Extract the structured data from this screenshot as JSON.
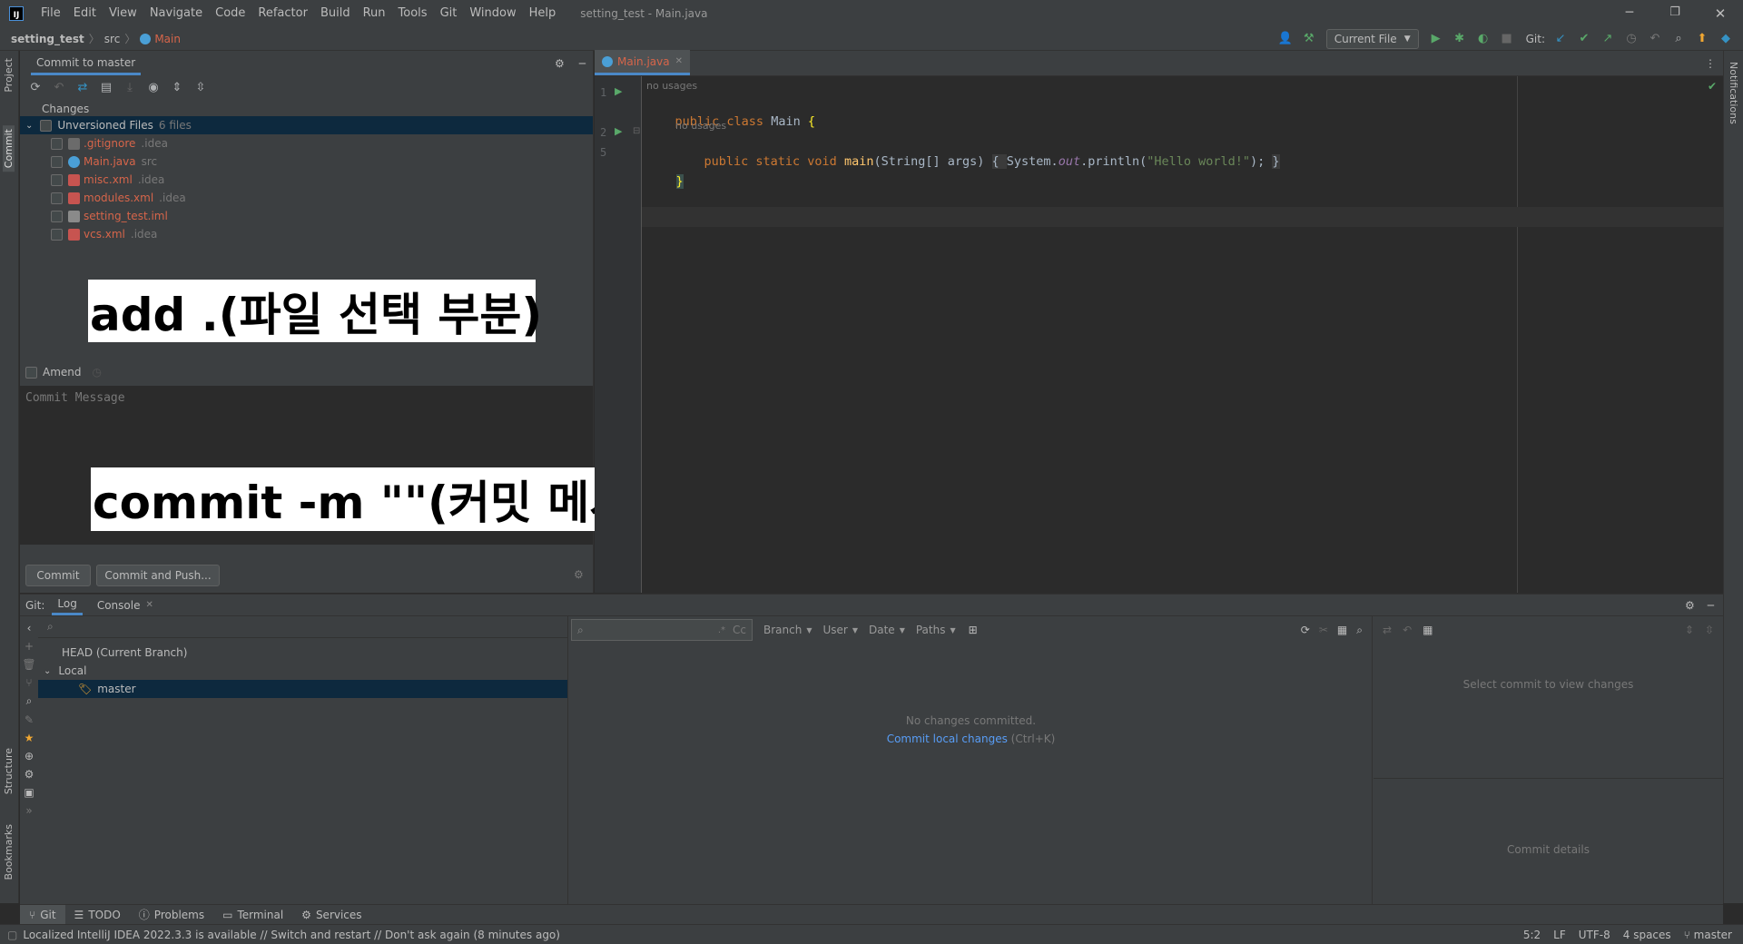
{
  "app": {
    "title": "setting_test - Main.java",
    "logo": "IJ"
  },
  "menu": [
    "File",
    "Edit",
    "View",
    "Navigate",
    "Code",
    "Refactor",
    "Build",
    "Run",
    "Tools",
    "Git",
    "Window",
    "Help"
  ],
  "breadcrumb": {
    "project": "setting_test",
    "dir": "src",
    "file": "Main"
  },
  "toolbar": {
    "run_config": "Current File",
    "git_label": "Git:"
  },
  "left_strip": {
    "project": "Project",
    "commit": "Commit",
    "structure": "Structure",
    "bookmarks": "Bookmarks"
  },
  "right_strip": {
    "notifications": "Notifications"
  },
  "commit_panel": {
    "title": "Commit to master",
    "changes_label": "Changes",
    "group": {
      "label": "Unversioned Files",
      "count": "6 files"
    },
    "files": [
      {
        "name": ".gitignore",
        "dir": ".idea"
      },
      {
        "name": "Main.java",
        "dir": "src"
      },
      {
        "name": "misc.xml",
        "dir": ".idea"
      },
      {
        "name": "modules.xml",
        "dir": ".idea"
      },
      {
        "name": "setting_test.iml",
        "dir": ""
      },
      {
        "name": "vcs.xml",
        "dir": ".idea"
      }
    ],
    "amend": "Amend",
    "message_placeholder": "Commit Message",
    "commit_button": "Commit",
    "commit_push_button": "Commit and Push..."
  },
  "captions": {
    "add": "add .(파일 선택 부분)",
    "commit": "commit -m \"\"(커밋 메시지 작성하는 부분)"
  },
  "editor": {
    "tab": "Main.java",
    "hint1": "no usages",
    "hint2": "no usages",
    "line_numbers": [
      "1",
      "2",
      "5"
    ],
    "line1": {
      "kw": "public class ",
      "name": "Main ",
      "brace": "{"
    },
    "line2": {
      "kw": "public static void ",
      "fn": "main",
      "params": "(String[] args) ",
      "b1": "{ ",
      "sys": "System.",
      "out": "out",
      "call": ".println(",
      "str": "\"Hello world!\"",
      "end": "); ",
      "b2": "}"
    },
    "line3": "}"
  },
  "git_panel": {
    "git_label": "Git:",
    "tabs": [
      "Log",
      "Console"
    ],
    "tree": {
      "head": "HEAD (Current Branch)",
      "local": "Local",
      "branch": "master"
    },
    "filters": [
      "Branch",
      "User",
      "Date",
      "Paths"
    ],
    "search_cc": "Cc",
    "empty_title": "No changes committed.",
    "empty_link": "Commit local changes",
    "empty_shortcut": "(Ctrl+K)",
    "select_commit": "Select commit to view changes",
    "commit_details": "Commit details"
  },
  "tool_windows": [
    "Git",
    "TODO",
    "Problems",
    "Terminal",
    "Services"
  ],
  "status": {
    "message": "Localized IntelliJ IDEA 2022.3.3 is available // Switch and restart // Don't ask again (8 minutes ago)",
    "position": "5:2",
    "line_sep": "LF",
    "encoding": "UTF-8",
    "indent": "4 spaces",
    "branch": "master"
  }
}
